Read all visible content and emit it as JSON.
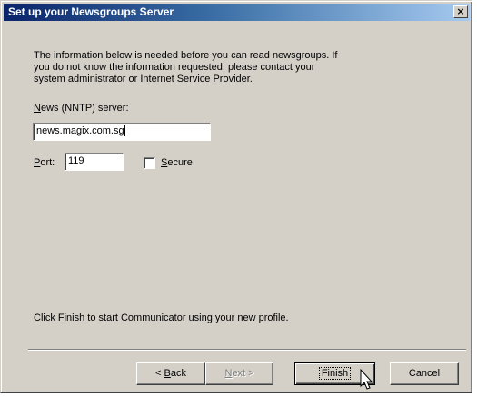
{
  "window": {
    "title": "Set up your Newsgroups Server",
    "close_glyph": "×"
  },
  "intro": {
    "line1": "The information below is needed before you can read newsgroups.  If",
    "line2": "you do not know the information requested, please contact your",
    "line3": "system administrator or Internet Service Provider."
  },
  "server": {
    "label_mnemonic": "N",
    "label_rest": "ews (NNTP) server:",
    "value": "news.magix.com.sg"
  },
  "port": {
    "label_mnemonic": "P",
    "label_rest": "ort:",
    "value": "119"
  },
  "secure": {
    "label_mnemonic": "S",
    "label_rest": "ecure",
    "checked": false
  },
  "footer_text": "Click Finish to start Communicator using your new profile.",
  "buttons": {
    "back_prefix": "< ",
    "back_mnemonic": "B",
    "back_rest": "ack",
    "next_mnemonic": "N",
    "next_rest": "ext >",
    "finish": "Finish",
    "cancel": "Cancel"
  },
  "colors": {
    "dialog_face": "#d4d0c8",
    "title_gradient_start": "#0a246a",
    "title_gradient_end": "#a6caf0"
  }
}
